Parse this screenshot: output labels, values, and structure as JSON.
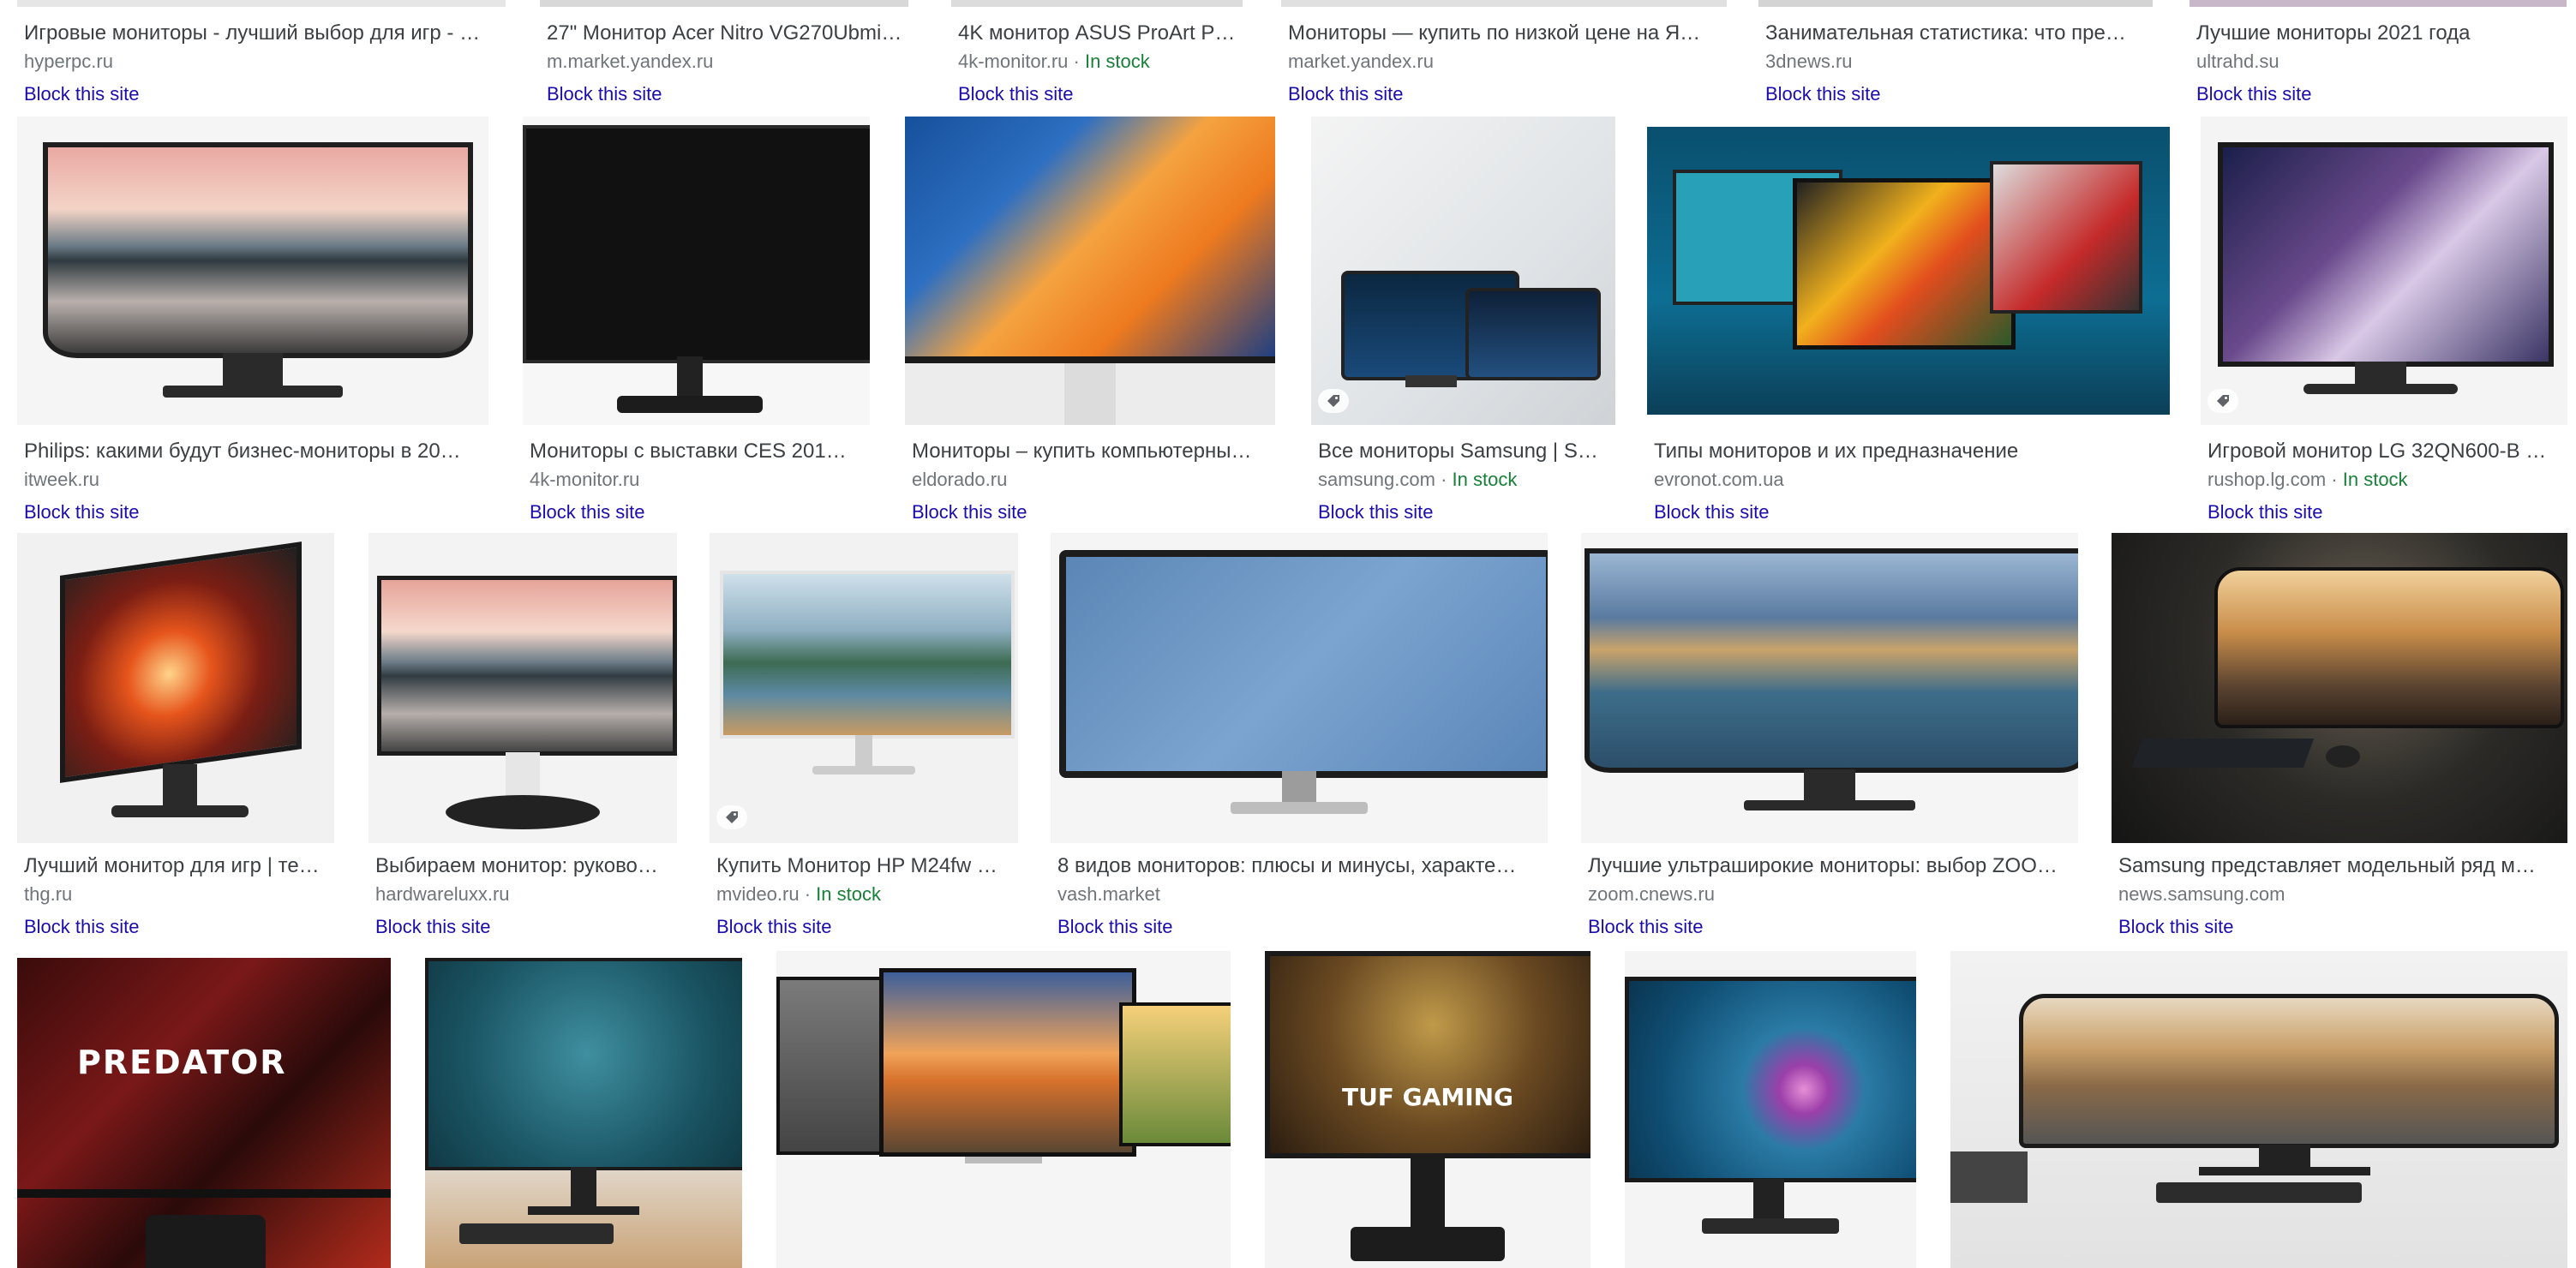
{
  "rows": [
    {
      "cards": [
        {
          "title": "Игровые мониторы - лучший выбор для игр - …",
          "source": "hyperpc.ru",
          "stock": "",
          "block": "Block this site"
        },
        {
          "title": "27\" Монитор Acer Nitro VG270Ubmi…",
          "source": "m.market.yandex.ru",
          "stock": "",
          "block": "Block this site"
        },
        {
          "title": "4K монитор ASUS ProArt P…",
          "source": "4k-monitor.ru",
          "stock": "In stock",
          "block": "Block this site"
        },
        {
          "title": "Мониторы — купить по низкой цене на Я…",
          "source": "market.yandex.ru",
          "stock": "",
          "block": "Block this site"
        },
        {
          "title": "Занимательная статистика: что пре…",
          "source": "3dnews.ru",
          "stock": "",
          "block": "Block this site"
        },
        {
          "title": "Лучшие мониторы 2021 года",
          "source": "ultrahd.su",
          "stock": "",
          "block": "Block this site"
        }
      ]
    },
    {
      "cards": [
        {
          "title": "Philips: какими будут бизнес-мониторы в 20…",
          "source": "itweek.ru",
          "stock": "",
          "block": "Block this site"
        },
        {
          "title": "Мониторы с выставки CES 201…",
          "source": "4k-monitor.ru",
          "stock": "",
          "block": "Block this site"
        },
        {
          "title": "Мониторы – купить компьютерны…",
          "source": "eldorado.ru",
          "stock": "",
          "block": "Block this site"
        },
        {
          "title": "Все мониторы Samsung | S…",
          "source": "samsung.com",
          "stock": "In stock",
          "block": "Block this site"
        },
        {
          "title": "Типы мониторов и их предназначение",
          "source": "evronot.com.ua",
          "stock": "",
          "block": "Block this site"
        },
        {
          "title": "Игровой монитор LG 32QN600-B …",
          "source": "rushop.lg.com",
          "stock": "In stock",
          "block": "Block this site"
        }
      ]
    },
    {
      "cards": [
        {
          "title": "Лучший монитор для игр | те…",
          "source": "thg.ru",
          "stock": "",
          "block": "Block this site"
        },
        {
          "title": "Выбираем монитор: руково…",
          "source": "hardwareluxx.ru",
          "stock": "",
          "block": "Block this site"
        },
        {
          "title": "Купить Монитор HP M24fw …",
          "source": "mvideo.ru",
          "stock": "In stock",
          "block": "Block this site"
        },
        {
          "title": "8 видов мониторов: плюсы и минусы, характе…",
          "source": "vash.market",
          "stock": "",
          "block": "Block this site"
        },
        {
          "title": "Лучшие ультраширокие мониторы: выбор ZOO…",
          "source": "zoom.cnews.ru",
          "stock": "",
          "block": "Block this site"
        },
        {
          "title": "Samsung представляет модельный ряд м…",
          "source": "news.samsung.com",
          "stock": "",
          "block": "Block this site"
        }
      ]
    }
  ],
  "thumbs_row4": [
    {
      "label": "PREDATOR"
    },
    {
      "label": ""
    },
    {
      "label": ""
    },
    {
      "label": "TUF GAMING"
    },
    {
      "label": ""
    },
    {
      "label": ""
    }
  ],
  "stock_separator": " · ",
  "colors": {
    "link": "#1a0dab",
    "stock": "#188038",
    "source": "#70757a",
    "title": "#3c4043"
  }
}
